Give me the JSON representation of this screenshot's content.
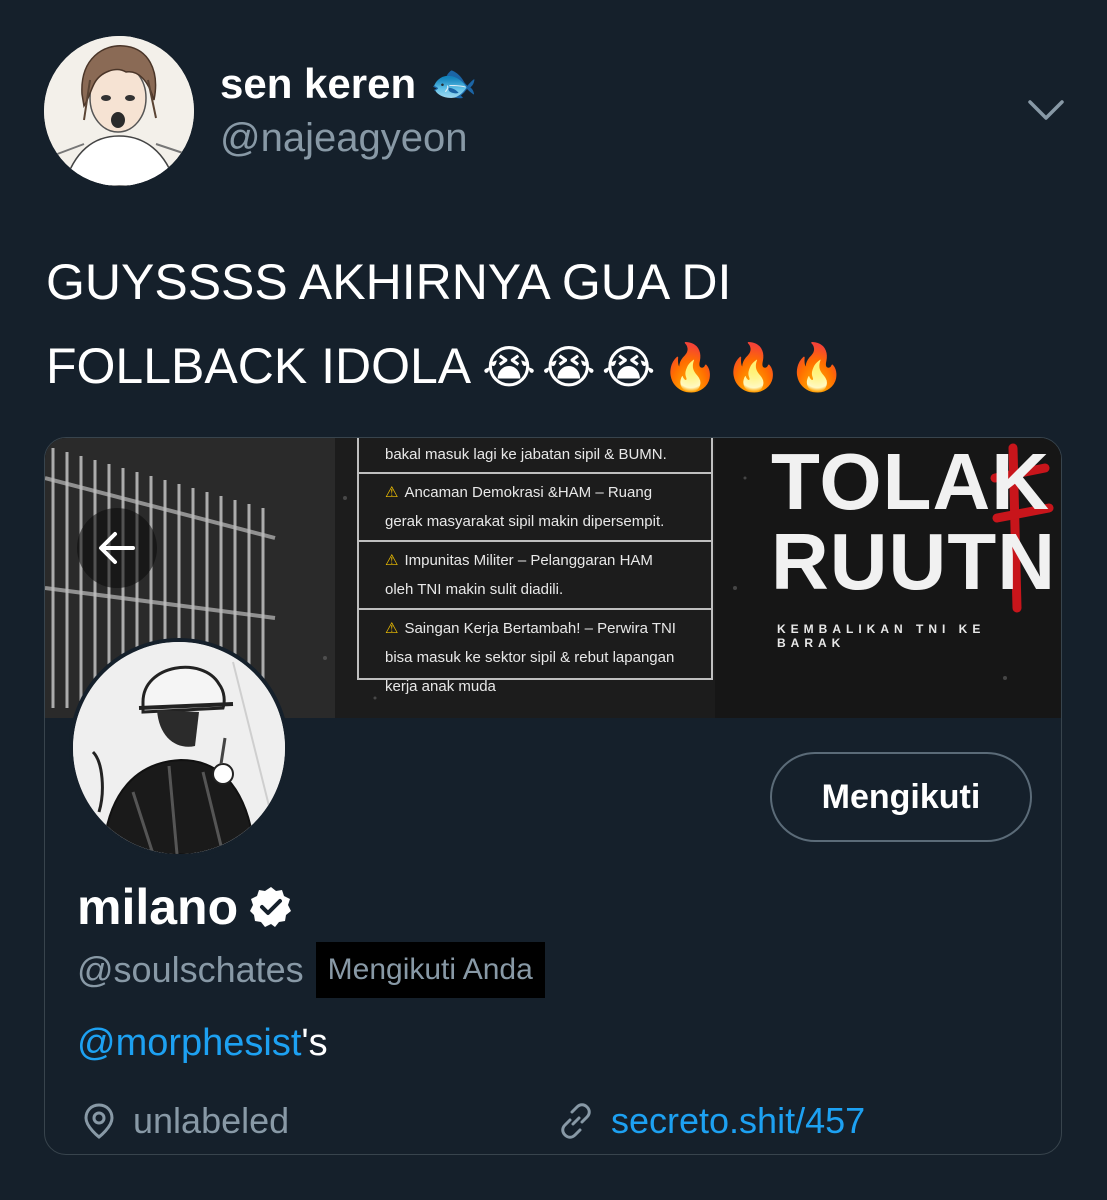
{
  "tweet": {
    "author_name": "sen keren",
    "author_emoji": "🐟",
    "author_handle": "@najeagyeon",
    "text_line1": "GUYSSSS AKHIRNYA GUA DI",
    "text_line2": "FOLLBACK IDOLA",
    "text_emojis": "😭😭😭🔥🔥🔥"
  },
  "card": {
    "banner": {
      "notice_top": "bakal masuk lagi ke jabatan sipil & BUMN.",
      "notice_items": [
        {
          "line1": "Ancaman Demokrasi &HAM – Ruang",
          "line2": "gerak masyarakat sipil makin dipersempit."
        },
        {
          "line1": "Impunitas Militer – Pelanggaran HAM",
          "line2": "oleh TNI makin sulit diadili."
        },
        {
          "line1": "Saingan Kerja Bertambah! – Perwira TNI",
          "line2": "bisa masuk ke sektor sipil & rebut lapangan",
          "line3": "kerja anak muda"
        }
      ],
      "title_line1": "TOLAK",
      "title_line2": "RUUTNI",
      "subtitle": "KEMBALIKAN TNI KE BARAK"
    },
    "follow_button": "Mengikuti",
    "profile_name": "milano",
    "profile_handle": "@soulschates",
    "follows_you": "Mengikuti Anda",
    "bio_mention": "@morphesist",
    "bio_suffix": "'s",
    "location": "unlabeled",
    "link": "secreto.shit/457"
  },
  "colors": {
    "background": "#15202b",
    "secondary_text": "#8899a6",
    "link": "#1da1f2",
    "border": "#38444d"
  },
  "icons": [
    "chevron-down-icon",
    "back-arrow-icon",
    "verified-badge-icon",
    "location-pin-icon",
    "link-icon"
  ]
}
